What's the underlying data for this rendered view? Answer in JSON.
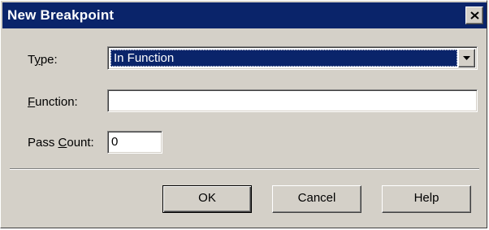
{
  "window": {
    "title": "New Breakpoint",
    "close_icon": "close-icon"
  },
  "form": {
    "type_label_mnemonic": "y",
    "type_label_pre": "T",
    "type_label_post": "pe:",
    "type_value": "In Function",
    "function_label_mnemonic": "F",
    "function_label_post": "unction:",
    "function_value": "",
    "pass_count_label_pre": "Pass ",
    "pass_count_label_mnemonic": "C",
    "pass_count_label_post": "ount:",
    "pass_count_value": "0"
  },
  "buttons": {
    "ok": "OK",
    "cancel": "Cancel",
    "help": "Help"
  },
  "colors": {
    "titlebar": "#0a246a",
    "face": "#d4d0c8",
    "selection": "#0a246a"
  }
}
